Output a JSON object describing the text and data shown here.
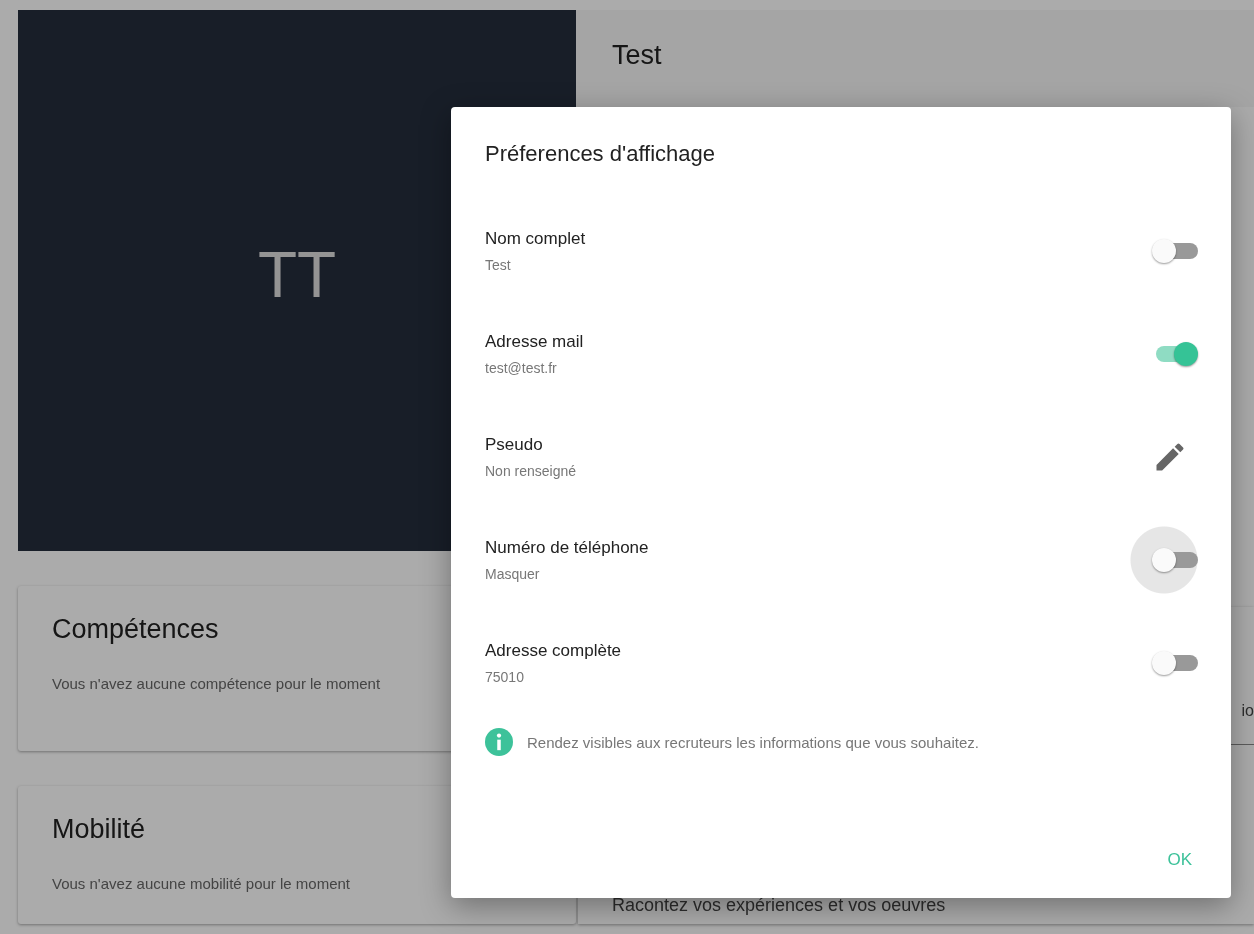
{
  "profile": {
    "initials": "TT",
    "name": "Test"
  },
  "cards": [
    {
      "title": "Compétences",
      "text": "Vous n'avez aucune compétence pour le moment"
    },
    {
      "title": "Mobilité",
      "text": "Vous n'avez aucune mobilité pour le moment"
    }
  ],
  "right_card": {
    "cut_text": "io",
    "text": "Racontez vos expériences et vos oeuvres"
  },
  "dialog": {
    "title": "Préferences d'affichage",
    "rows": [
      {
        "kind": "switch",
        "label": "Nom complet",
        "value": "Test",
        "on": false,
        "focused": false
      },
      {
        "kind": "switch",
        "label": "Adresse mail",
        "value": "test@test.fr",
        "on": true,
        "focused": false
      },
      {
        "kind": "edit",
        "label": "Pseudo",
        "value": "Non renseigné"
      },
      {
        "kind": "switch",
        "label": "Numéro de téléphone",
        "value": "Masquer",
        "on": false,
        "focused": true
      },
      {
        "kind": "switch",
        "label": "Adresse complète",
        "value": "75010",
        "on": false,
        "focused": false
      }
    ],
    "info": "Rendez visibles aux recruteurs les informations que vous souhaitez.",
    "ok_button": "OK"
  }
}
